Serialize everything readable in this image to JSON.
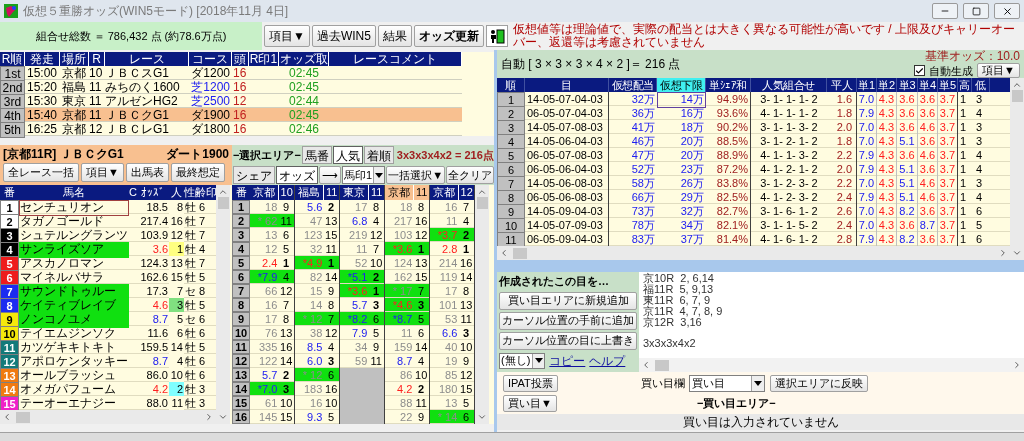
{
  "window": {
    "title": "仮想５重勝オッズ(WIN5モード) [2018年11月 4日]"
  },
  "toolbar": {
    "total": "組合せ総数 ＝ 786,432 点 (約78.6万点)",
    "buttons": [
      "項目▼",
      "過去WIN5",
      "結果",
      "オッズ更新"
    ],
    "warning": "仮想値等は理論値で、実際の配当とは大きく異なる可能性が高いです / 上限及びキャリーオーバー、返還等は考慮されていません"
  },
  "races": {
    "columns": [
      "R順",
      "発走",
      "場所",
      "R",
      "レース",
      "コース",
      "頭",
      "R印1",
      "オッズ取",
      "レースコメント"
    ],
    "rows": [
      {
        "order": "1st",
        "start": "15:00",
        "venue": "京都",
        "race": "10",
        "name": "ＪＢＣスG1",
        "course": {
          "text": "ダ1200",
          "kind": "dirt"
        },
        "runners": "16",
        "odds_time": "02:45",
        "selected": false
      },
      {
        "order": "2nd",
        "start": "15:20",
        "venue": "福島",
        "race": "11",
        "name": "みちのく1600",
        "course": {
          "text": "芝1200",
          "kind": "turf"
        },
        "runners": "16",
        "odds_time": "02:45",
        "selected": false
      },
      {
        "order": "3rd",
        "start": "15:30",
        "venue": "東京",
        "race": "11",
        "name": "アルゼンHG2",
        "course": {
          "text": "芝2500",
          "kind": "turf"
        },
        "runners": "12",
        "odds_time": "02:44",
        "selected": false
      },
      {
        "order": "4th",
        "start": "15:40",
        "venue": "京都",
        "race": "11",
        "name": "ＪＢＣクG1",
        "course": {
          "text": "ダ1900",
          "kind": "dirt"
        },
        "runners": "16",
        "odds_time": "02:45",
        "selected": true
      },
      {
        "order": "5th",
        "start": "16:25",
        "venue": "京都",
        "race": "12",
        "name": "ＪＢＣレG1",
        "course": {
          "text": "ダ1800",
          "kind": "dirt"
        },
        "runners": "16",
        "odds_time": "02:46",
        "selected": false
      }
    ]
  },
  "horses": {
    "race_title": "[京都11R] ＪＢＣクG1",
    "distance": "ダート1900",
    "buttons": [
      "全レース一括",
      "項目▼",
      "出馬表",
      "最終想定"
    ],
    "columns": [
      "番",
      "馬名",
      "C",
      "ｵｯｽﾞ",
      "人",
      "性齢",
      "印"
    ],
    "rows": [
      {
        "number": "1",
        "color": "#ffffff",
        "name": "センチュリオン",
        "odds": {
          "text": "18.5",
          "kind": "long"
        },
        "pop": {
          "text": "8",
          "color": "#fffce0"
        },
        "sex_age": "牡 6",
        "selected": false,
        "focused": true
      },
      {
        "number": "2",
        "color": "#ffffff",
        "name": "タガノゴールド",
        "odds": {
          "text": "217.4",
          "kind": "long"
        },
        "pop": {
          "text": "16",
          "color": "#fffce0"
        },
        "sex_age": "牡 7",
        "selected": false,
        "focused": false
      },
      {
        "number": "3",
        "color": "#000000",
        "name": "シュテルングランツ",
        "odds": {
          "text": "103.9",
          "kind": "long"
        },
        "pop": {
          "text": "12",
          "color": "#fffce0"
        },
        "sex_age": "牡 7",
        "selected": false,
        "focused": false
      },
      {
        "number": "4",
        "color": "#000000",
        "name": "サンライズソア",
        "odds": {
          "text": "3.6",
          "kind": "short"
        },
        "pop": {
          "text": "1",
          "color": "#ffff80"
        },
        "sex_age": "牡 4",
        "selected": true,
        "focused": false
      },
      {
        "number": "5",
        "color": "#ee1c1c",
        "name": "アスカノロマン",
        "odds": {
          "text": "124.3",
          "kind": "long"
        },
        "pop": {
          "text": "13",
          "color": "#fffce0"
        },
        "sex_age": "牡 7",
        "selected": false,
        "focused": false
      },
      {
        "number": "6",
        "color": "#ee1c1c",
        "name": "マイネルバサラ",
        "odds": {
          "text": "162.6",
          "kind": "long"
        },
        "pop": {
          "text": "15",
          "color": "#fffce0"
        },
        "sex_age": "牡 5",
        "selected": false,
        "focused": false
      },
      {
        "number": "7",
        "color": "#1c2cf0",
        "name": "サウンドトゥルー",
        "odds": {
          "text": "17.3",
          "kind": "long"
        },
        "pop": {
          "text": "7",
          "color": "#fffce0"
        },
        "sex_age": "セ 8",
        "selected": true,
        "focused": false
      },
      {
        "number": "8",
        "color": "#1c2cf0",
        "name": "ケイティブレイブ",
        "odds": {
          "text": "4.6",
          "kind": "short"
        },
        "pop": {
          "text": "3",
          "color": "#80e080"
        },
        "sex_age": "牡 5",
        "selected": true,
        "focused": false
      },
      {
        "number": "9",
        "color": "#f5e80c",
        "name": "ノンコノユメ",
        "odds": {
          "text": "8.7",
          "kind": "mid"
        },
        "pop": {
          "text": "5",
          "color": "#fffce0"
        },
        "sex_age": "セ 6",
        "selected": true,
        "focused": false
      },
      {
        "number": "10",
        "color": "#f5e80c",
        "name": "テイエムジンソク",
        "odds": {
          "text": "11.6",
          "kind": "long"
        },
        "pop": {
          "text": "6",
          "color": "#fffce0"
        },
        "sex_age": "牡 6",
        "selected": false,
        "focused": false
      },
      {
        "number": "11",
        "color": "#127a7a",
        "name": "カツゲキキトキト",
        "odds": {
          "text": "159.5",
          "kind": "long"
        },
        "pop": {
          "text": "14",
          "color": "#fffce0"
        },
        "sex_age": "牡 5",
        "selected": false,
        "focused": false
      },
      {
        "number": "12",
        "color": "#127a7a",
        "name": "アポロケンタッキー",
        "odds": {
          "text": "8.7",
          "kind": "mid"
        },
        "pop": {
          "text": "4",
          "color": "#fffce0"
        },
        "sex_age": "牡 6",
        "selected": false,
        "focused": false
      },
      {
        "number": "13",
        "color": "#f07a10",
        "name": "オールブラッシュ",
        "odds": {
          "text": "86.0",
          "kind": "long"
        },
        "pop": {
          "text": "10",
          "color": "#fffce0"
        },
        "sex_age": "牡 6",
        "selected": false,
        "focused": false
      },
      {
        "number": "14",
        "color": "#f07a10",
        "name": "オメガパフューム",
        "odds": {
          "text": "4.2",
          "kind": "short"
        },
        "pop": {
          "text": "2",
          "color": "#80ffff"
        },
        "sex_age": "牡 3",
        "selected": false,
        "focused": false
      },
      {
        "number": "15",
        "color": "#f020c8",
        "name": "テーオーエナジー",
        "odds": {
          "text": "88.0",
          "kind": "long"
        },
        "pop": {
          "text": "11",
          "color": "#fffce0"
        },
        "sex_age": "牡 3",
        "selected": false,
        "focused": false
      }
    ]
  },
  "selection": {
    "title": "−選択エリア−",
    "sort_tabs": [
      {
        "label": "馬番",
        "selected": false
      },
      {
        "label": "人気",
        "selected": true
      },
      {
        "label": "着順",
        "selected": false
      }
    ],
    "formula": "3x3x3x4x2 = 216点",
    "mode_tabs": [
      {
        "label": "シェア",
        "selected": false
      },
      {
        "label": "オッズ",
        "selected": true
      }
    ],
    "arrow": "⟶",
    "mark_select": "馬印1",
    "bulk_button": "一括選択▼",
    "clear_button": "全クリア",
    "number_header": "番",
    "numbers": [
      "1",
      "2",
      "3",
      "4",
      "5",
      "6",
      "7",
      "8",
      "9",
      "10",
      "11",
      "12",
      "13",
      "14",
      "15",
      "16"
    ],
    "races": [
      {
        "venue": "京都",
        "race": "10",
        "selected": false,
        "cells": [
          {
            "odds": {
              "text": "18",
              "kind": "long"
            },
            "pop": "9",
            "selected": false,
            "bold": false
          },
          {
            "odds": {
              "text": "* 62",
              "kind": "long"
            },
            "pop": "11",
            "selected": true,
            "bold": false
          },
          {
            "odds": {
              "text": "13",
              "kind": "long"
            },
            "pop": "6",
            "selected": false,
            "bold": false
          },
          {
            "odds": {
              "text": "12",
              "kind": "long"
            },
            "pop": "5",
            "selected": false,
            "bold": false
          },
          {
            "odds": {
              "text": "2.4",
              "kind": "short"
            },
            "pop": "1",
            "selected": false,
            "bold": true
          },
          {
            "odds": {
              "text": "*7.9",
              "kind": "mid"
            },
            "pop": "4",
            "selected": true,
            "bold": false
          },
          {
            "odds": {
              "text": "66",
              "kind": "long"
            },
            "pop": "12",
            "selected": false,
            "bold": false
          },
          {
            "odds": {
              "text": "16",
              "kind": "long"
            },
            "pop": "7",
            "selected": false,
            "bold": false
          },
          {
            "odds": {
              "text": "17",
              "kind": "long"
            },
            "pop": "8",
            "selected": false,
            "bold": false
          },
          {
            "odds": {
              "text": "76",
              "kind": "long"
            },
            "pop": "13",
            "selected": false,
            "bold": false
          },
          {
            "odds": {
              "text": "335",
              "kind": "long"
            },
            "pop": "16",
            "selected": false,
            "bold": false
          },
          {
            "odds": {
              "text": "122",
              "kind": "long"
            },
            "pop": "14",
            "selected": false,
            "bold": false
          },
          {
            "odds": {
              "text": "5.7",
              "kind": "mid"
            },
            "pop": "2",
            "selected": false,
            "bold": true
          },
          {
            "odds": {
              "text": "*7.0",
              "kind": "mid"
            },
            "pop": "3",
            "selected": true,
            "bold": true
          },
          {
            "odds": {
              "text": "61",
              "kind": "long"
            },
            "pop": "10",
            "selected": false,
            "bold": false
          },
          {
            "odds": {
              "text": "145",
              "kind": "long"
            },
            "pop": "15",
            "selected": false,
            "bold": false
          }
        ]
      },
      {
        "venue": "福島",
        "race": "11",
        "selected": false,
        "cells": [
          {
            "odds": {
              "text": "5.6",
              "kind": "mid"
            },
            "pop": "2",
            "selected": false,
            "bold": true
          },
          {
            "odds": {
              "text": "47",
              "kind": "long"
            },
            "pop": "13",
            "selected": false,
            "bold": false
          },
          {
            "odds": {
              "text": "123",
              "kind": "long"
            },
            "pop": "15",
            "selected": false,
            "bold": false
          },
          {
            "odds": {
              "text": "32",
              "kind": "long"
            },
            "pop": "11",
            "selected": false,
            "bold": false
          },
          {
            "odds": {
              "text": "*4.9",
              "kind": "short"
            },
            "pop": "1",
            "selected": true,
            "bold": true
          },
          {
            "odds": {
              "text": "82",
              "kind": "long"
            },
            "pop": "14",
            "selected": false,
            "bold": false
          },
          {
            "odds": {
              "text": "15",
              "kind": "long"
            },
            "pop": "9",
            "selected": false,
            "bold": false
          },
          {
            "odds": {
              "text": "14",
              "kind": "long"
            },
            "pop": "8",
            "selected": false,
            "bold": false
          },
          {
            "odds": {
              "text": "* 12",
              "kind": "long"
            },
            "pop": "7",
            "selected": true,
            "bold": false
          },
          {
            "odds": {
              "text": "38",
              "kind": "long"
            },
            "pop": "12",
            "selected": false,
            "bold": false
          },
          {
            "odds": {
              "text": "8.5",
              "kind": "mid"
            },
            "pop": "4",
            "selected": false,
            "bold": false
          },
          {
            "odds": {
              "text": "6.0",
              "kind": "mid"
            },
            "pop": "3",
            "selected": false,
            "bold": true
          },
          {
            "odds": {
              "text": "* 12",
              "kind": "long"
            },
            "pop": "6",
            "selected": true,
            "bold": false
          },
          {
            "odds": {
              "text": "183",
              "kind": "long"
            },
            "pop": "16",
            "selected": false,
            "bold": false
          },
          {
            "odds": {
              "text": "16",
              "kind": "long"
            },
            "pop": "10",
            "selected": false,
            "bold": false
          },
          {
            "odds": {
              "text": "9.3",
              "kind": "mid"
            },
            "pop": "5",
            "selected": false,
            "bold": false
          }
        ]
      },
      {
        "venue": "東京",
        "race": "11",
        "selected": false,
        "cells": [
          {
            "odds": {
              "text": "17",
              "kind": "long"
            },
            "pop": "8",
            "selected": false,
            "bold": false
          },
          {
            "odds": {
              "text": "6.8",
              "kind": "mid"
            },
            "pop": "4",
            "selected": false,
            "bold": false
          },
          {
            "odds": {
              "text": "219",
              "kind": "long"
            },
            "pop": "12",
            "selected": false,
            "bold": false
          },
          {
            "odds": {
              "text": "11",
              "kind": "long"
            },
            "pop": "7",
            "selected": false,
            "bold": false
          },
          {
            "odds": {
              "text": "52",
              "kind": "long"
            },
            "pop": "10",
            "selected": false,
            "bold": false
          },
          {
            "odds": {
              "text": "*5.1",
              "kind": "mid"
            },
            "pop": "2",
            "selected": true,
            "bold": true
          },
          {
            "odds": {
              "text": "*3.6",
              "kind": "short"
            },
            "pop": "1",
            "selected": true,
            "bold": true
          },
          {
            "odds": {
              "text": "5.7",
              "kind": "mid"
            },
            "pop": "3",
            "selected": false,
            "bold": true
          },
          {
            "odds": {
              "text": "*8.2",
              "kind": "mid"
            },
            "pop": "6",
            "selected": true,
            "bold": false
          },
          {
            "odds": {
              "text": "7.9",
              "kind": "mid"
            },
            "pop": "5",
            "selected": false,
            "bold": false
          },
          {
            "odds": {
              "text": "34",
              "kind": "long"
            },
            "pop": "9",
            "selected": false,
            "bold": false
          },
          {
            "odds": {
              "text": "59",
              "kind": "long"
            },
            "pop": "11",
            "selected": false,
            "bold": false
          }
        ]
      },
      {
        "venue": "京都",
        "race": "11",
        "selected": true,
        "cells": [
          {
            "odds": {
              "text": "18",
              "kind": "long"
            },
            "pop": "8",
            "selected": false,
            "bold": false
          },
          {
            "odds": {
              "text": "217",
              "kind": "long"
            },
            "pop": "16",
            "selected": false,
            "bold": false
          },
          {
            "odds": {
              "text": "103",
              "kind": "long"
            },
            "pop": "12",
            "selected": false,
            "bold": false
          },
          {
            "odds": {
              "text": "*3.6",
              "kind": "short"
            },
            "pop": "1",
            "selected": true,
            "bold": true
          },
          {
            "odds": {
              "text": "124",
              "kind": "long"
            },
            "pop": "13",
            "selected": false,
            "bold": false
          },
          {
            "odds": {
              "text": "162",
              "kind": "long"
            },
            "pop": "15",
            "selected": false,
            "bold": false
          },
          {
            "odds": {
              "text": "* 17",
              "kind": "long"
            },
            "pop": "7",
            "selected": true,
            "bold": false
          },
          {
            "odds": {
              "text": "*4.6",
              "kind": "short"
            },
            "pop": "3",
            "selected": true,
            "bold": true
          },
          {
            "odds": {
              "text": "*8.7",
              "kind": "mid"
            },
            "pop": "5",
            "selected": true,
            "bold": false
          },
          {
            "odds": {
              "text": "11",
              "kind": "long"
            },
            "pop": "6",
            "selected": false,
            "bold": false
          },
          {
            "odds": {
              "text": "159",
              "kind": "long"
            },
            "pop": "14",
            "selected": false,
            "bold": false
          },
          {
            "odds": {
              "text": "8.7",
              "kind": "mid"
            },
            "pop": "4",
            "selected": false,
            "bold": false
          },
          {
            "odds": {
              "text": "86",
              "kind": "long"
            },
            "pop": "10",
            "selected": false,
            "bold": false
          },
          {
            "odds": {
              "text": "4.2",
              "kind": "short"
            },
            "pop": "2",
            "selected": false,
            "bold": true
          },
          {
            "odds": {
              "text": "88",
              "kind": "long"
            },
            "pop": "11",
            "selected": false,
            "bold": false
          },
          {
            "odds": {
              "text": "22",
              "kind": "long"
            },
            "pop": "9",
            "selected": false,
            "bold": false
          }
        ]
      },
      {
        "venue": "京都",
        "race": "12",
        "selected": false,
        "cells": [
          {
            "odds": {
              "text": "16",
              "kind": "long"
            },
            "pop": "7",
            "selected": false,
            "bold": false
          },
          {
            "odds": {
              "text": "11",
              "kind": "long"
            },
            "pop": "4",
            "selected": false,
            "bold": false
          },
          {
            "odds": {
              "text": "*3.7",
              "kind": "short"
            },
            "pop": "2",
            "selected": true,
            "bold": true
          },
          {
            "odds": {
              "text": "2.8",
              "kind": "short"
            },
            "pop": "1",
            "selected": false,
            "bold": true
          },
          {
            "odds": {
              "text": "214",
              "kind": "long"
            },
            "pop": "16",
            "selected": false,
            "bold": false
          },
          {
            "odds": {
              "text": "119",
              "kind": "long"
            },
            "pop": "14",
            "selected": false,
            "bold": false
          },
          {
            "odds": {
              "text": "17",
              "kind": "long"
            },
            "pop": "8",
            "selected": false,
            "bold": false
          },
          {
            "odds": {
              "text": "101",
              "kind": "long"
            },
            "pop": "13",
            "selected": false,
            "bold": false
          },
          {
            "odds": {
              "text": "53",
              "kind": "long"
            },
            "pop": "11",
            "selected": false,
            "bold": false
          },
          {
            "odds": {
              "text": "6.6",
              "kind": "mid"
            },
            "pop": "3",
            "selected": false,
            "bold": true
          },
          {
            "odds": {
              "text": "40",
              "kind": "long"
            },
            "pop": "10",
            "selected": false,
            "bold": false
          },
          {
            "odds": {
              "text": "19",
              "kind": "long"
            },
            "pop": "9",
            "selected": false,
            "bold": false
          },
          {
            "odds": {
              "text": "85",
              "kind": "long"
            },
            "pop": "12",
            "selected": false,
            "bold": false
          },
          {
            "odds": {
              "text": "180",
              "kind": "long"
            },
            "pop": "15",
            "selected": false,
            "bold": false
          },
          {
            "odds": {
              "text": "13",
              "kind": "long"
            },
            "pop": "5",
            "selected": false,
            "bold": false
          },
          {
            "odds": {
              "text": "* 14",
              "kind": "long"
            },
            "pop": "6",
            "selected": true,
            "bold": false
          }
        ]
      }
    ]
  },
  "combos": {
    "summary": "自動 [ 3 × 3 × 3 × 4 × 2 ]＝ 216 点",
    "base_odds": "基準オッズ：10.0",
    "auto_generate": {
      "label": "自動生成",
      "checked": true
    },
    "menu_button": "項目▼",
    "columns": [
      {
        "label": "順",
        "highlighted": false
      },
      {
        "label": "目",
        "highlighted": false
      },
      {
        "label": "仮想配当",
        "highlighted": false
      },
      {
        "label": "仮想下限",
        "highlighted": true
      },
      {
        "label": "単ｼｪｱ和",
        "highlighted": false
      },
      {
        "label": "人気組合せ",
        "highlighted": false
      },
      {
        "label": "平人",
        "highlighted": false
      },
      {
        "label": "単1",
        "highlighted": false
      },
      {
        "label": "単2",
        "highlighted": false
      },
      {
        "label": "単3",
        "highlighted": false
      },
      {
        "label": "単4",
        "highlighted": false
      },
      {
        "label": "単5",
        "highlighted": false
      },
      {
        "label": "高",
        "highlighted": false
      },
      {
        "label": "低",
        "highlighted": false
      }
    ],
    "rows": [
      {
        "rank": "1",
        "combo": "14-05-07-04-03",
        "payout": "32万",
        "lower": "14万",
        "share": "94.9%",
        "popularity": "3- 1- 1- 1- 2",
        "avg": "1.6",
        "singles": [
          {
            "odds": "7.0",
            "kind": "mid"
          },
          {
            "odds": "4.3",
            "kind": "short"
          },
          {
            "odds": "3.6",
            "kind": "short"
          },
          {
            "odds": "3.6",
            "kind": "short"
          },
          {
            "odds": "3.7",
            "kind": "short"
          }
        ],
        "high": "1",
        "low": "3",
        "focused": true
      },
      {
        "rank": "2",
        "combo": "06-05-07-04-03",
        "payout": "36万",
        "lower": "16万",
        "share": "93.6%",
        "popularity": "4- 1- 1- 1- 2",
        "avg": "1.8",
        "singles": [
          {
            "odds": "7.9",
            "kind": "mid"
          },
          {
            "odds": "4.3",
            "kind": "short"
          },
          {
            "odds": "3.6",
            "kind": "short"
          },
          {
            "odds": "3.6",
            "kind": "short"
          },
          {
            "odds": "3.7",
            "kind": "short"
          }
        ],
        "high": "1",
        "low": "4",
        "focused": false
      },
      {
        "rank": "3",
        "combo": "14-05-07-08-03",
        "payout": "41万",
        "lower": "18万",
        "share": "90.2%",
        "popularity": "3- 1- 1- 3- 2",
        "avg": "2.0",
        "singles": [
          {
            "odds": "7.0",
            "kind": "mid"
          },
          {
            "odds": "4.3",
            "kind": "short"
          },
          {
            "odds": "3.6",
            "kind": "short"
          },
          {
            "odds": "4.6",
            "kind": "short"
          },
          {
            "odds": "3.7",
            "kind": "short"
          }
        ],
        "high": "1",
        "low": "3",
        "focused": false
      },
      {
        "rank": "4",
        "combo": "14-05-06-04-03",
        "payout": "46万",
        "lower": "20万",
        "share": "88.5%",
        "popularity": "3- 1- 2- 1- 2",
        "avg": "1.8",
        "singles": [
          {
            "odds": "7.0",
            "kind": "mid"
          },
          {
            "odds": "4.3",
            "kind": "short"
          },
          {
            "odds": "5.1",
            "kind": "mid"
          },
          {
            "odds": "3.6",
            "kind": "short"
          },
          {
            "odds": "3.7",
            "kind": "short"
          }
        ],
        "high": "1",
        "low": "3",
        "focused": false
      },
      {
        "rank": "5",
        "combo": "06-05-07-08-03",
        "payout": "47万",
        "lower": "20万",
        "share": "88.9%",
        "popularity": "4- 1- 1- 3- 2",
        "avg": "2.2",
        "singles": [
          {
            "odds": "7.9",
            "kind": "mid"
          },
          {
            "odds": "4.3",
            "kind": "short"
          },
          {
            "odds": "3.6",
            "kind": "short"
          },
          {
            "odds": "4.6",
            "kind": "short"
          },
          {
            "odds": "3.7",
            "kind": "short"
          }
        ],
        "high": "1",
        "low": "4",
        "focused": false
      },
      {
        "rank": "6",
        "combo": "06-05-06-04-03",
        "payout": "52万",
        "lower": "23万",
        "share": "87.2%",
        "popularity": "4- 1- 2- 1- 2",
        "avg": "2.0",
        "singles": [
          {
            "odds": "7.9",
            "kind": "mid"
          },
          {
            "odds": "4.3",
            "kind": "short"
          },
          {
            "odds": "5.1",
            "kind": "mid"
          },
          {
            "odds": "3.6",
            "kind": "short"
          },
          {
            "odds": "3.7",
            "kind": "short"
          }
        ],
        "high": "1",
        "low": "4",
        "focused": false
      },
      {
        "rank": "7",
        "combo": "14-05-06-08-03",
        "payout": "58万",
        "lower": "26万",
        "share": "83.8%",
        "popularity": "3- 1- 2- 3- 2",
        "avg": "2.2",
        "singles": [
          {
            "odds": "7.0",
            "kind": "mid"
          },
          {
            "odds": "4.3",
            "kind": "short"
          },
          {
            "odds": "5.1",
            "kind": "mid"
          },
          {
            "odds": "4.6",
            "kind": "short"
          },
          {
            "odds": "3.7",
            "kind": "short"
          }
        ],
        "high": "1",
        "low": "3",
        "focused": false
      },
      {
        "rank": "8",
        "combo": "06-05-06-08-03",
        "payout": "66万",
        "lower": "29万",
        "share": "82.5%",
        "popularity": "4- 1- 2- 3- 2",
        "avg": "2.4",
        "singles": [
          {
            "odds": "7.9",
            "kind": "mid"
          },
          {
            "odds": "4.3",
            "kind": "short"
          },
          {
            "odds": "5.1",
            "kind": "mid"
          },
          {
            "odds": "4.6",
            "kind": "short"
          },
          {
            "odds": "3.7",
            "kind": "short"
          }
        ],
        "high": "1",
        "low": "4",
        "focused": false
      },
      {
        "rank": "9",
        "combo": "14-05-09-04-03",
        "payout": "73万",
        "lower": "32万",
        "share": "82.7%",
        "popularity": "3- 1- 6- 1- 2",
        "avg": "2.6",
        "singles": [
          {
            "odds": "7.0",
            "kind": "mid"
          },
          {
            "odds": "4.3",
            "kind": "short"
          },
          {
            "odds": "8.2",
            "kind": "mid"
          },
          {
            "odds": "3.6",
            "kind": "short"
          },
          {
            "odds": "3.7",
            "kind": "short"
          }
        ],
        "high": "1",
        "low": "6",
        "focused": false
      },
      {
        "rank": "10",
        "combo": "14-05-07-09-03",
        "payout": "78万",
        "lower": "34万",
        "share": "82.1%",
        "popularity": "3- 1- 1- 5- 2",
        "avg": "2.4",
        "singles": [
          {
            "odds": "7.0",
            "kind": "mid"
          },
          {
            "odds": "4.3",
            "kind": "short"
          },
          {
            "odds": "3.6",
            "kind": "short"
          },
          {
            "odds": "8.7",
            "kind": "mid"
          },
          {
            "odds": "3.7",
            "kind": "short"
          }
        ],
        "high": "1",
        "low": "5",
        "focused": false
      },
      {
        "rank": "11",
        "combo": "06-05-09-04-03",
        "payout": "83万",
        "lower": "37万",
        "share": "81.4%",
        "popularity": "4- 1- 6- 1- 2",
        "avg": "2.8",
        "singles": [
          {
            "odds": "7.9",
            "kind": "mid"
          },
          {
            "odds": "4.3",
            "kind": "short"
          },
          {
            "odds": "8.2",
            "kind": "mid"
          },
          {
            "odds": "3.6",
            "kind": "short"
          },
          {
            "odds": "3.7",
            "kind": "short"
          }
        ],
        "high": "1",
        "low": "6",
        "focused": false
      }
    ]
  },
  "creator": {
    "title": "作成されたこの目を…",
    "buttons": [
      "買い目エリアに新規追加",
      "カーソル位置の手前に追加",
      "カーソル位置の目に上書き"
    ],
    "select": "(無し)",
    "links": [
      "コピー",
      "ヘルプ"
    ],
    "lines": [
      "京10R  2, 6,14",
      "福11R  5, 9,13",
      "東11R  6, 7, 9",
      "京11R  4, 7, 8, 9",
      "京12R  3,16"
    ],
    "formula": "3x3x3x4x2"
  },
  "bets": {
    "ipat_button": "IPAT投票",
    "menu_button": "買い目▼",
    "field_label": "買い目欄",
    "field_value": "買い目",
    "apply_button": "選択エリアに反映",
    "area_title": "−買い目エリア−",
    "empty_message": "買い目は入力されていません"
  }
}
